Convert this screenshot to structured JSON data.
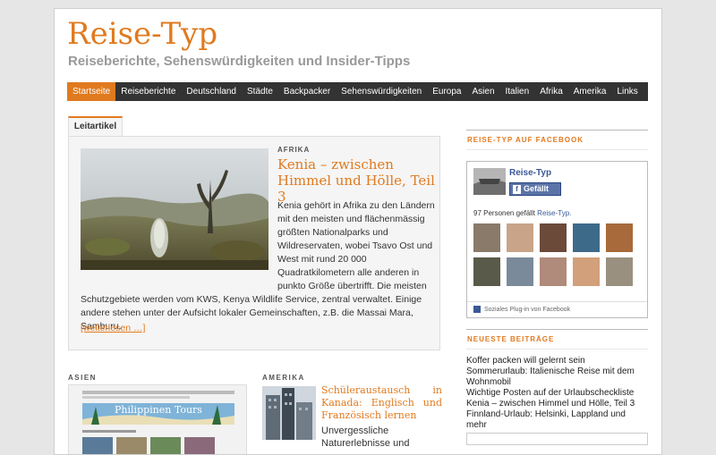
{
  "site": {
    "title": "Reise-Typ",
    "description": "Reiseberichte, Sehenswürdigkeiten und Insider-Tipps"
  },
  "nav": {
    "items": [
      "Startseite",
      "Reiseberichte",
      "Deutschland",
      "Städte",
      "Backpacker",
      "Sehenswürdigkeiten",
      "Europa",
      "Asien",
      "Italien",
      "Afrika",
      "Amerika",
      "Links"
    ],
    "active": "Startseite"
  },
  "featured": {
    "tab_label": "Leitartikel",
    "category": "AFRIKA",
    "title": "Kenia – zwischen Himmel und Hölle, Teil 3",
    "excerpt": "Kenia gehört in Afrika zu den Ländern mit den meisten und flächenmässig größten Nationalparks und Wildreservaten, wobei Tsavo Ost und West mit rund 20 000 Quadratkilometern alle anderen in punkto Größe übertrifft. Die meisten Schutzgebiete werden vom KWS, Kenya Wildlife Service, zentral verwaltet. Einige andere stehen unter der Aufsicht lokaler Gemeinschaften, z.B. die Massai Mara, Samburu.",
    "read_more": "[weiterlesen …]"
  },
  "sections": {
    "asia": {
      "label": "ASIEN",
      "image_caption": "Philippinen Tours"
    },
    "america": {
      "label": "AMERIKA",
      "title": "Schüleraustausch in Kanada: Englisch und Französisch lernen",
      "excerpt": "Unvergessliche Naturerlebnisse und"
    }
  },
  "sidebar": {
    "facebook": {
      "heading": "REISE-TYP AUF FACEBOOK",
      "page_name": "Reise-Typ",
      "like_label": "Gefällt mir",
      "count_text": "97 Personen gefällt ",
      "count_link": "Reise-Typ.",
      "plugin_text": "Soziales Plug-in von Facebook"
    },
    "recent": {
      "heading": "NEUESTE BEITRÄGE",
      "posts": [
        "Koffer packen will gelernt sein",
        "Sommerurlaub: Italienische Reise mit dem Wohnmobil",
        "Wichtige Posten auf der Urlaubscheckliste",
        "Kenia – zwischen Himmel und Hölle, Teil 3",
        "Finnland-Urlaub: Helsinki, Lappland und mehr"
      ]
    }
  },
  "colors": {
    "accent": "#e07a1f",
    "nav_bg": "#333333",
    "facebook": "#3b5998"
  }
}
